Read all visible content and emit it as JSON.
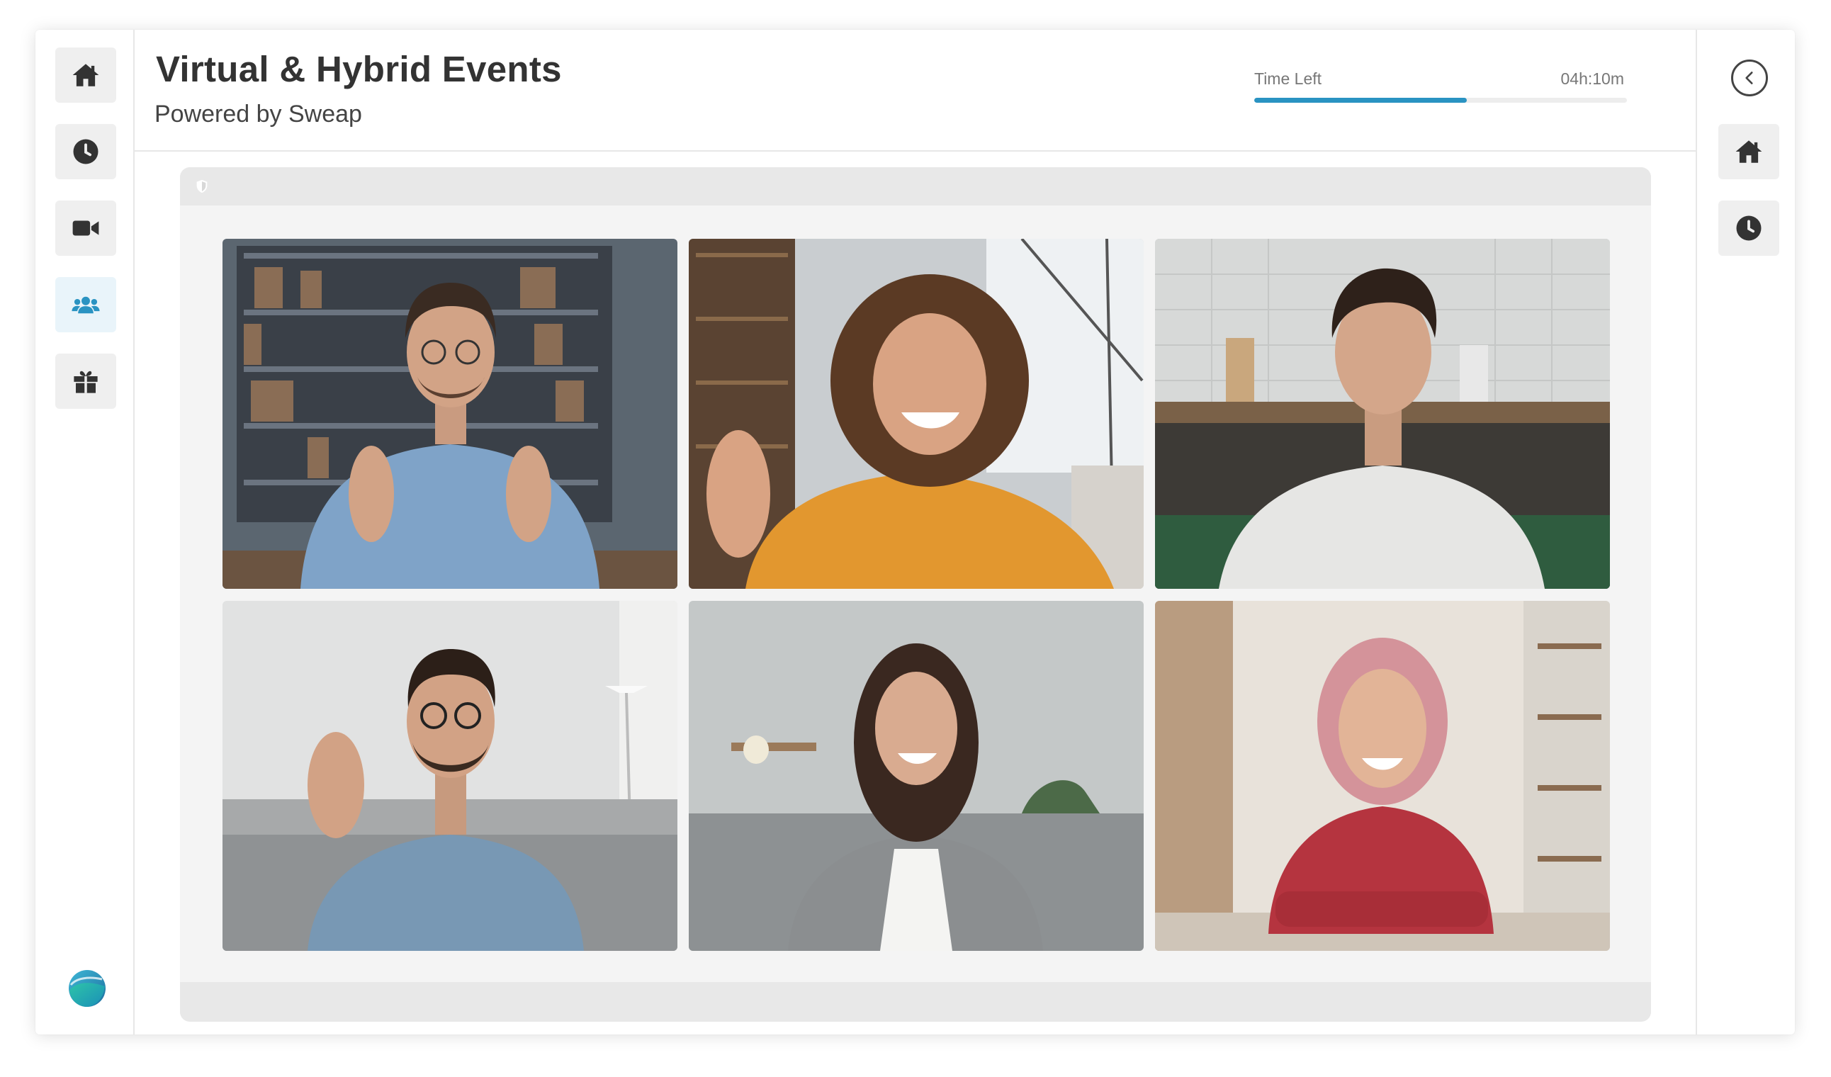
{
  "header": {
    "title": "Virtual & Hybrid Events",
    "subtitle": "Powered by Sweap"
  },
  "timer": {
    "label": "Time Left",
    "value": "04h:10m",
    "progress_fraction": 0.57
  },
  "left_nav": {
    "items": [
      {
        "name": "home",
        "icon": "home-icon"
      },
      {
        "name": "schedule",
        "icon": "clock-icon"
      },
      {
        "name": "video",
        "icon": "video-camera-icon"
      },
      {
        "name": "people",
        "icon": "users-icon",
        "active": true
      },
      {
        "name": "gifts",
        "icon": "gift-icon"
      }
    ],
    "logo": "sweap-logo"
  },
  "right_nav": {
    "items": [
      {
        "name": "collapse",
        "icon": "chevron-left-icon"
      },
      {
        "name": "home",
        "icon": "home-icon"
      },
      {
        "name": "schedule",
        "icon": "clock-icon"
      }
    ]
  },
  "video_grid": {
    "participants": [
      {
        "id": 1,
        "description": "man with glasses in blue shirt, bookshelf background"
      },
      {
        "id": 2,
        "description": "curly-haired woman in orange hoodie waving"
      },
      {
        "id": 3,
        "description": "man in white t-shirt, kitchen background"
      },
      {
        "id": 4,
        "description": "bearded man with glasses waving on sofa"
      },
      {
        "id": 5,
        "description": "woman with long dark hair in grey cardigan"
      },
      {
        "id": 6,
        "description": "woman with pink hair in red blouse, arms crossed"
      }
    ]
  },
  "colors": {
    "accent": "#2a93c2",
    "icon": "#333333",
    "rail_button": "#efefef",
    "active_rail_button": "#e9f4fa"
  }
}
